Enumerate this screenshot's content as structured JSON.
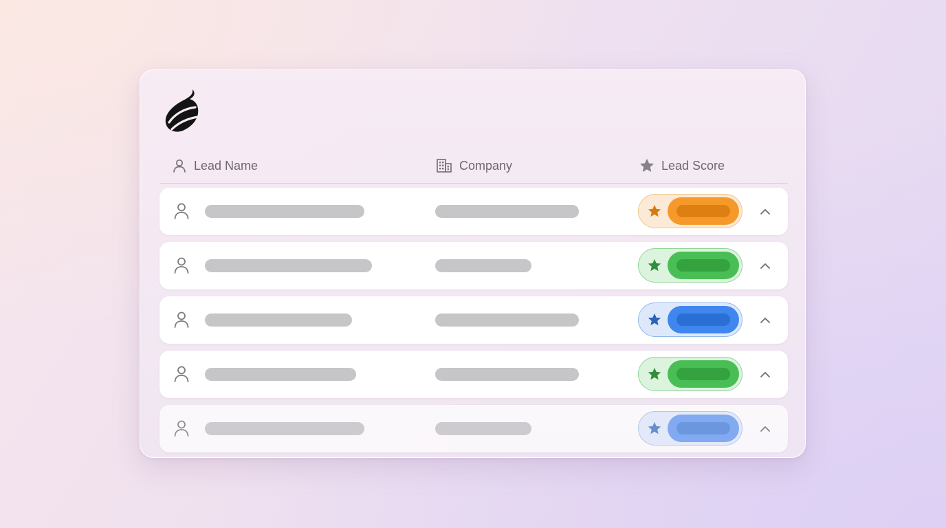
{
  "table": {
    "columns": [
      {
        "label": "Lead Name",
        "icon": "user-icon"
      },
      {
        "label": "Company",
        "icon": "building-icon"
      },
      {
        "label": "Lead Score",
        "icon": "star-icon"
      }
    ],
    "rows": [
      {
        "name_placeholder": "skeleton",
        "company_placeholder": "skeleton",
        "score_color": "orange",
        "expanded_icon": "chevron-up-icon"
      },
      {
        "name_placeholder": "skeleton",
        "company_placeholder": "skeleton",
        "score_color": "green",
        "expanded_icon": "chevron-up-icon"
      },
      {
        "name_placeholder": "skeleton",
        "company_placeholder": "skeleton",
        "score_color": "blue",
        "expanded_icon": "chevron-up-icon"
      },
      {
        "name_placeholder": "skeleton",
        "company_placeholder": "skeleton",
        "score_color": "green",
        "expanded_icon": "chevron-up-icon"
      },
      {
        "name_placeholder": "skeleton",
        "company_placeholder": "skeleton",
        "score_color": "blue",
        "expanded_icon": "chevron-up-icon"
      }
    ]
  },
  "logo": {
    "icon": "flame-leaf-logo"
  },
  "colors": {
    "orange": "#f59a2a",
    "green": "#49be55",
    "blue": "#3f86ee",
    "skeleton": "#c6c6c8",
    "header_text": "#6d6870"
  }
}
